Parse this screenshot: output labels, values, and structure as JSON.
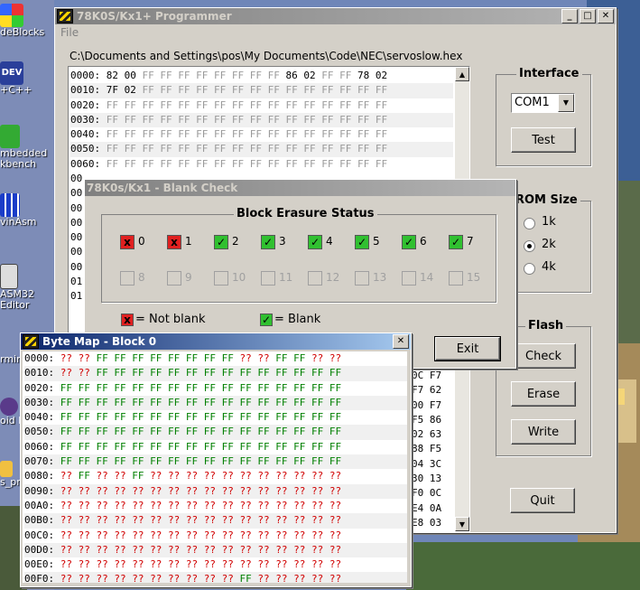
{
  "desktop": {
    "icons": [
      {
        "label": "deBlocks",
        "y": 0
      },
      {
        "label": "+C++",
        "y": 0
      },
      {
        "label": "mbedded",
        "y": 0
      },
      {
        "label": "kbench",
        "y": 0
      },
      {
        "label": "vinAsm",
        "y": 0
      },
      {
        "label": "ASM32",
        "y": 0
      },
      {
        "label": "Editor",
        "y": 0
      },
      {
        "label": "rmina",
        "y": 0
      },
      {
        "label": "oid D",
        "y": 0
      },
      {
        "label": "s_pro",
        "y": 0
      }
    ],
    "dev_badge": "DEV"
  },
  "main_window": {
    "title": "78K0S/Kx1+ Programmer",
    "menu": "File",
    "file_path": "C:\\Documents and Settings\\pos\\My Documents\\Code\\NEC\\servoslow.hex",
    "hex_rows": [
      {
        "addr": "0000:",
        "cells": [
          "82",
          "00",
          "FF",
          "FF",
          "FF",
          "FF",
          "FF",
          "FF",
          "FF",
          "FF",
          "86",
          "02",
          "FF",
          "FF",
          "78",
          "02"
        ]
      },
      {
        "addr": "0010:",
        "cells": [
          "7F",
          "02",
          "FF",
          "FF",
          "FF",
          "FF",
          "FF",
          "FF",
          "FF",
          "FF",
          "FF",
          "FF",
          "FF",
          "FF",
          "FF",
          "FF"
        ]
      },
      {
        "addr": "0020:",
        "cells": [
          "FF",
          "FF",
          "FF",
          "FF",
          "FF",
          "FF",
          "FF",
          "FF",
          "FF",
          "FF",
          "FF",
          "FF",
          "FF",
          "FF",
          "FF",
          "FF"
        ]
      },
      {
        "addr": "0030:",
        "cells": [
          "FF",
          "FF",
          "FF",
          "FF",
          "FF",
          "FF",
          "FF",
          "FF",
          "FF",
          "FF",
          "FF",
          "FF",
          "FF",
          "FF",
          "FF",
          "FF"
        ]
      },
      {
        "addr": "0040:",
        "cells": [
          "FF",
          "FF",
          "FF",
          "FF",
          "FF",
          "FF",
          "FF",
          "FF",
          "FF",
          "FF",
          "FF",
          "FF",
          "FF",
          "FF",
          "FF",
          "FF"
        ]
      },
      {
        "addr": "0050:",
        "cells": [
          "FF",
          "FF",
          "FF",
          "FF",
          "FF",
          "FF",
          "FF",
          "FF",
          "FF",
          "FF",
          "FF",
          "FF",
          "FF",
          "FF",
          "FF",
          "FF"
        ]
      },
      {
        "addr": "0060:",
        "cells": [
          "FF",
          "FF",
          "FF",
          "FF",
          "FF",
          "FF",
          "FF",
          "FF",
          "FF",
          "FF",
          "FF",
          "FF",
          "FF",
          "FF",
          "FF",
          "FF"
        ]
      }
    ],
    "hex_tail": [
      {
        "a": "0C",
        "b": "F7"
      },
      {
        "a": "F7",
        "b": "62"
      },
      {
        "a": "00",
        "b": "F7"
      },
      {
        "a": "F5",
        "b": "86"
      },
      {
        "a": "02",
        "b": "63"
      },
      {
        "a": "88",
        "b": "F5"
      },
      {
        "a": "04",
        "b": "3C"
      },
      {
        "a": "30",
        "b": "13"
      },
      {
        "a": "F0",
        "b": "0C"
      },
      {
        "a": "E4",
        "b": "0A"
      },
      {
        "a": "E8",
        "b": "03"
      }
    ],
    "hex_hidden_prefix": [
      "00",
      "00",
      "00",
      "00",
      "00",
      "00",
      "00",
      "01",
      "01"
    ],
    "interface": {
      "title": "Interface",
      "port": "COM1",
      "test_label": "Test"
    },
    "rom_size": {
      "title": "ROM Size",
      "options": [
        "1k",
        "2k",
        "4k"
      ],
      "selected": "2k"
    },
    "flash": {
      "title": "Flash",
      "check": "Check",
      "erase": "Erase",
      "write": "Write"
    },
    "quit_label": "Quit"
  },
  "blank_check": {
    "title": "78K0s/Kx1 - Blank Check",
    "group_title": "Block Erasure Status",
    "row1": [
      {
        "n": "0",
        "state": "red",
        "mark": "x"
      },
      {
        "n": "1",
        "state": "red",
        "mark": "x"
      },
      {
        "n": "2",
        "state": "green",
        "mark": "✓"
      },
      {
        "n": "3",
        "state": "green",
        "mark": "✓"
      },
      {
        "n": "4",
        "state": "green",
        "mark": "✓"
      },
      {
        "n": "5",
        "state": "green",
        "mark": "✓"
      },
      {
        "n": "6",
        "state": "green",
        "mark": "✓"
      },
      {
        "n": "7",
        "state": "green",
        "mark": "✓"
      }
    ],
    "row2": [
      "8",
      "9",
      "10",
      "11",
      "12",
      "13",
      "14",
      "15"
    ],
    "legend_not_blank": "= Not blank",
    "legend_blank": "= Blank",
    "exit_label": "Exit",
    "legend_x": "x",
    "legend_check": "✓"
  },
  "byte_map": {
    "title": "Byte Map - Block 0",
    "rows": [
      {
        "addr": "0000:",
        "cells": [
          "??",
          "??",
          "FF",
          "FF",
          "FF",
          "FF",
          "FF",
          "FF",
          "FF",
          "FF",
          "??",
          "??",
          "FF",
          "FF",
          "??",
          "??"
        ]
      },
      {
        "addr": "0010:",
        "cells": [
          "??",
          "??",
          "FF",
          "FF",
          "FF",
          "FF",
          "FF",
          "FF",
          "FF",
          "FF",
          "FF",
          "FF",
          "FF",
          "FF",
          "FF",
          "FF"
        ]
      },
      {
        "addr": "0020:",
        "cells": [
          "FF",
          "FF",
          "FF",
          "FF",
          "FF",
          "FF",
          "FF",
          "FF",
          "FF",
          "FF",
          "FF",
          "FF",
          "FF",
          "FF",
          "FF",
          "FF"
        ]
      },
      {
        "addr": "0030:",
        "cells": [
          "FF",
          "FF",
          "FF",
          "FF",
          "FF",
          "FF",
          "FF",
          "FF",
          "FF",
          "FF",
          "FF",
          "FF",
          "FF",
          "FF",
          "FF",
          "FF"
        ]
      },
      {
        "addr": "0040:",
        "cells": [
          "FF",
          "FF",
          "FF",
          "FF",
          "FF",
          "FF",
          "FF",
          "FF",
          "FF",
          "FF",
          "FF",
          "FF",
          "FF",
          "FF",
          "FF",
          "FF"
        ]
      },
      {
        "addr": "0050:",
        "cells": [
          "FF",
          "FF",
          "FF",
          "FF",
          "FF",
          "FF",
          "FF",
          "FF",
          "FF",
          "FF",
          "FF",
          "FF",
          "FF",
          "FF",
          "FF",
          "FF"
        ]
      },
      {
        "addr": "0060:",
        "cells": [
          "FF",
          "FF",
          "FF",
          "FF",
          "FF",
          "FF",
          "FF",
          "FF",
          "FF",
          "FF",
          "FF",
          "FF",
          "FF",
          "FF",
          "FF",
          "FF"
        ]
      },
      {
        "addr": "0070:",
        "cells": [
          "FF",
          "FF",
          "FF",
          "FF",
          "FF",
          "FF",
          "FF",
          "FF",
          "FF",
          "FF",
          "FF",
          "FF",
          "FF",
          "FF",
          "FF",
          "FF"
        ]
      },
      {
        "addr": "0080:",
        "cells": [
          "??",
          "FF",
          "??",
          "??",
          "FF",
          "??",
          "??",
          "??",
          "??",
          "??",
          "??",
          "??",
          "??",
          "??",
          "??",
          "??"
        ]
      },
      {
        "addr": "0090:",
        "cells": [
          "??",
          "??",
          "??",
          "??",
          "??",
          "??",
          "??",
          "??",
          "??",
          "??",
          "??",
          "??",
          "??",
          "??",
          "??",
          "??"
        ]
      },
      {
        "addr": "00A0:",
        "cells": [
          "??",
          "??",
          "??",
          "??",
          "??",
          "??",
          "??",
          "??",
          "??",
          "??",
          "??",
          "??",
          "??",
          "??",
          "??",
          "??"
        ]
      },
      {
        "addr": "00B0:",
        "cells": [
          "??",
          "??",
          "??",
          "??",
          "??",
          "??",
          "??",
          "??",
          "??",
          "??",
          "??",
          "??",
          "??",
          "??",
          "??",
          "??"
        ]
      },
      {
        "addr": "00C0:",
        "cells": [
          "??",
          "??",
          "??",
          "??",
          "??",
          "??",
          "??",
          "??",
          "??",
          "??",
          "??",
          "??",
          "??",
          "??",
          "??",
          "??"
        ]
      },
      {
        "addr": "00D0:",
        "cells": [
          "??",
          "??",
          "??",
          "??",
          "??",
          "??",
          "??",
          "??",
          "??",
          "??",
          "??",
          "??",
          "??",
          "??",
          "??",
          "??"
        ]
      },
      {
        "addr": "00E0:",
        "cells": [
          "??",
          "??",
          "??",
          "??",
          "??",
          "??",
          "??",
          "??",
          "??",
          "??",
          "??",
          "??",
          "??",
          "??",
          "??",
          "??"
        ]
      },
      {
        "addr": "00F0:",
        "cells": [
          "??",
          "??",
          "??",
          "??",
          "??",
          "??",
          "??",
          "??",
          "??",
          "??",
          "FF",
          "??",
          "??",
          "??",
          "??",
          "??"
        ]
      }
    ]
  }
}
